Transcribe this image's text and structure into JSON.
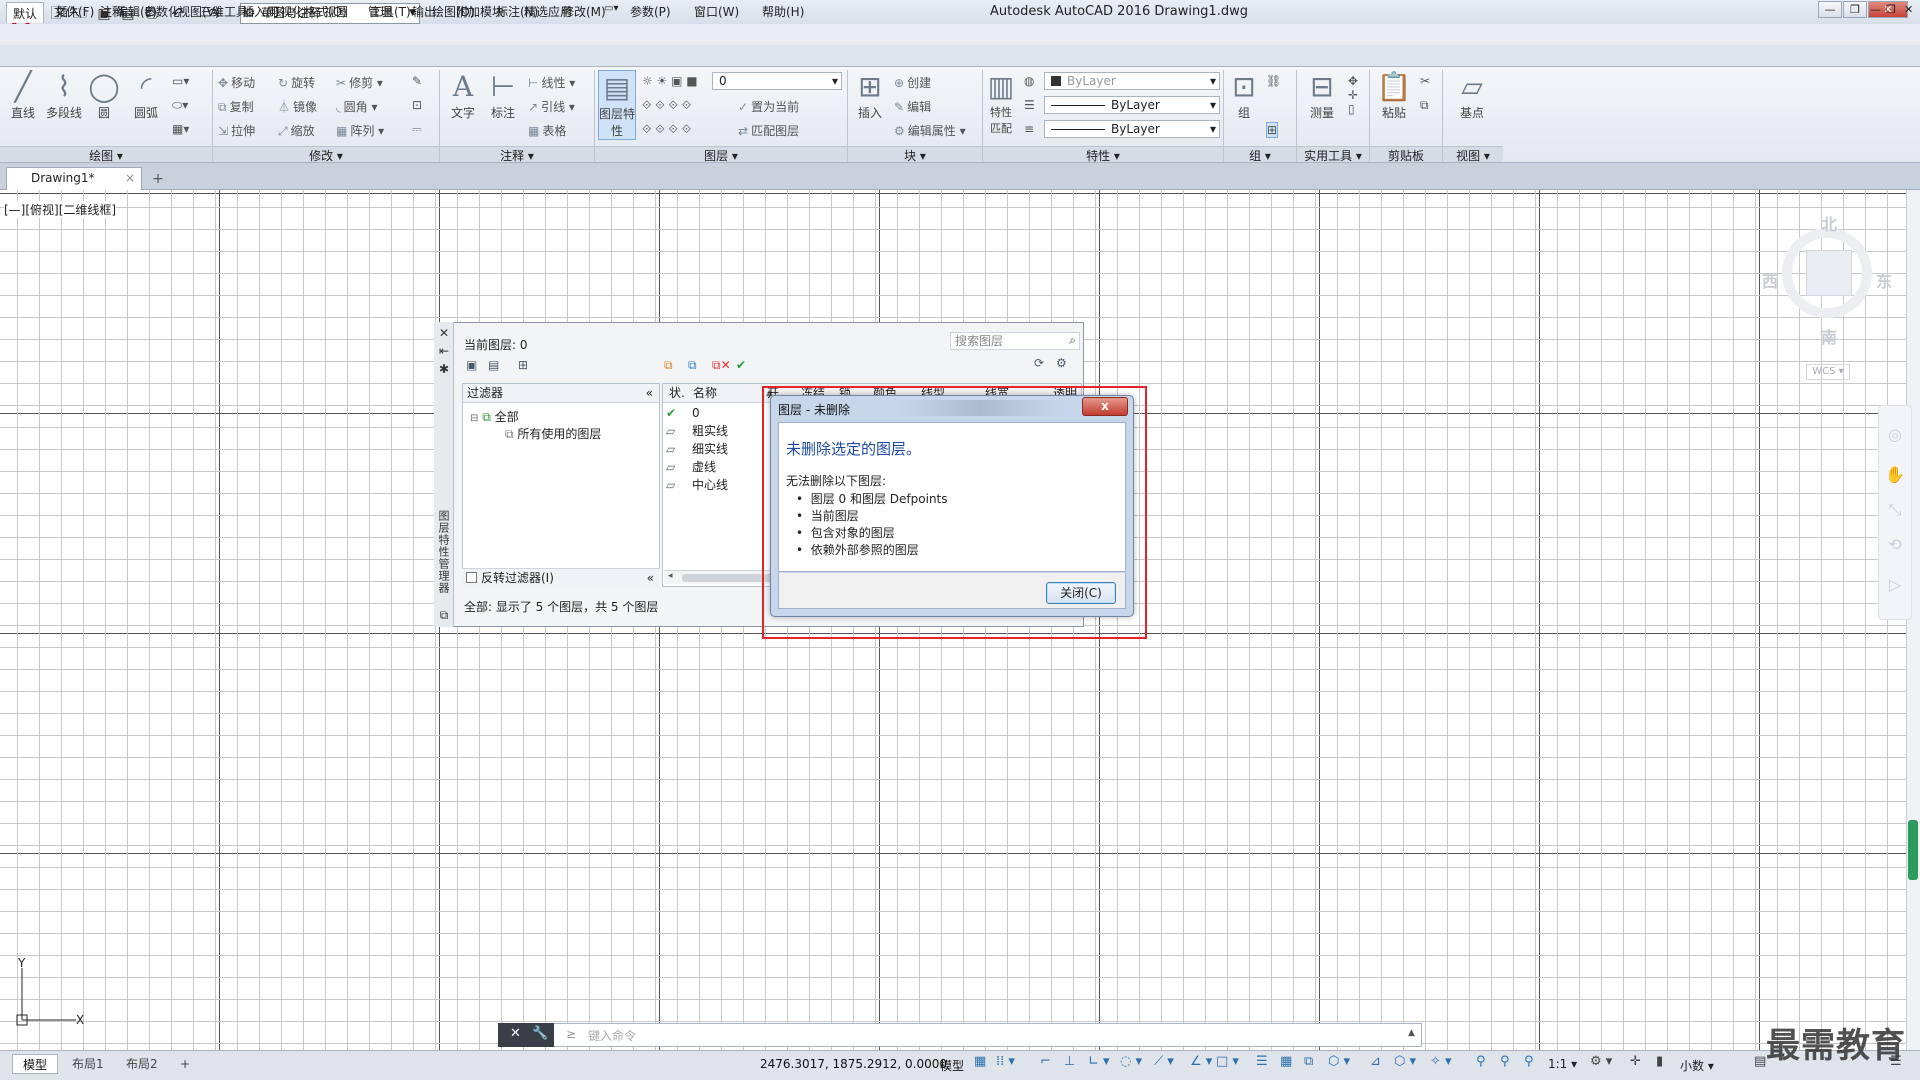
{
  "app": {
    "title": "Autodesk AutoCAD 2016    Drawing1.dwg",
    "logo": "A",
    "workspace": "草图与注释"
  },
  "menu": [
    "文件(F)",
    "编辑(E)",
    "视图(V)",
    "插入(I)",
    "格式(O)",
    "工具(T)",
    "绘图(D)",
    "标注(N)",
    "修改(M)",
    "参数(P)",
    "窗口(W)",
    "帮助(H)"
  ],
  "ribbon_tabs": [
    "默认",
    "插入",
    "注释",
    "参数化",
    "三维工具",
    "可视化",
    "视图",
    "管理",
    "输出",
    "附加模块",
    "精选应用"
  ],
  "ribbon": {
    "draw": {
      "title": "绘图",
      "line": "直线",
      "polyline": "多段线",
      "circle": "圆",
      "arc": "圆弧"
    },
    "modify": {
      "title": "修改",
      "move": "移动",
      "rotate": "旋转",
      "trim": "修剪",
      "copy": "复制",
      "mirror": "镜像",
      "fillet": "圆角",
      "stretch": "拉伸",
      "scale": "缩放",
      "array": "阵列"
    },
    "annotation": {
      "title": "注释",
      "text": "文字",
      "dimension": "标注",
      "linear": "线性",
      "leader": "引线",
      "table": "表格"
    },
    "layers": {
      "title": "图层",
      "layer_props": "图层特性",
      "layer_value": "0",
      "make_current": "置为当前",
      "match": "匹配图层"
    },
    "block": {
      "title": "块",
      "insert": "插入",
      "create": "创建",
      "edit": "编辑",
      "edit_attr": "编辑属性"
    },
    "properties": {
      "title": "特性",
      "match_props": "特性匹配",
      "color": "ByLayer",
      "linetype": "ByLayer",
      "lineweight": "ByLayer"
    },
    "groups": {
      "title": "组",
      "group": "组"
    },
    "utilities": {
      "title": "实用工具",
      "measure": "测量"
    },
    "clipboard": {
      "title": "剪贴板",
      "paste": "粘贴"
    },
    "view": {
      "title": "视图",
      "base": "基点"
    }
  },
  "file_tab": {
    "name": "Drawing1*",
    "close": "×",
    "new": "+"
  },
  "viewport_label": "[—][俯视][二维线框]",
  "viewcube": {
    "north": "北",
    "south": "南",
    "east": "东",
    "west": "西",
    "wcs": "WCS"
  },
  "layer_palette": {
    "current": "当前图层: 0",
    "search_placeholder": "搜索图层",
    "filter_header": "过滤器",
    "tree": {
      "all": "全部",
      "used": "所有使用的图层"
    },
    "invert_filter": "反转过滤器(I)",
    "columns": [
      "状.",
      "名称",
      "开",
      "冻结",
      "锁",
      "颜色",
      "线型",
      "线宽",
      "透明"
    ],
    "layers": [
      {
        "name": "0",
        "current": true
      },
      {
        "name": "粗实线"
      },
      {
        "name": "细实线"
      },
      {
        "name": "虚线"
      },
      {
        "name": "中心线"
      }
    ],
    "status": "全部: 显示了 5 个图层，共 5 个图层",
    "vertical_label": "图层特性管理器"
  },
  "dialog": {
    "title": "图层 - 未删除",
    "heading": "未删除选定的图层。",
    "intro": "无法删除以下图层:",
    "items": [
      "图层 0 和图层 Defpoints",
      "当前图层",
      "包含对象的图层",
      "依赖外部参照的图层"
    ],
    "close_button": "关闭(C)",
    "close_x": "x"
  },
  "command": {
    "placeholder": "键入命令",
    "prompt": "≥"
  },
  "status": {
    "tabs": [
      "模型",
      "布局1",
      "布局2"
    ],
    "coords": "2476.3017, 1875.2912, 0.0000",
    "model": "模型",
    "scale": "1:1",
    "units": "小数"
  },
  "watermark": "最需教育",
  "colors": {
    "highlight": "#e8222a",
    "dialog_heading": "#1c4aa8",
    "scroll_thumb": "#2e9b5e"
  }
}
